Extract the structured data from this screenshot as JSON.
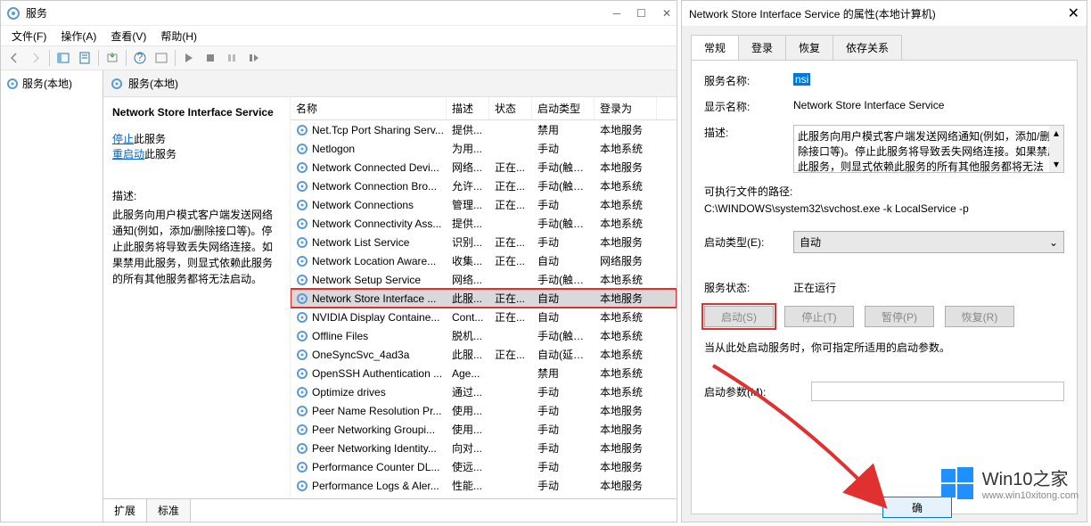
{
  "main": {
    "title": "服务",
    "menubar": [
      "文件(F)",
      "操作(A)",
      "查看(V)",
      "帮助(H)"
    ],
    "nav_root": "服务(本地)",
    "detail_header": "服务(本地)",
    "info": {
      "title": "Network Store Interface Service",
      "stop_link_prefix": "停止",
      "stop_link_suffix": "此服务",
      "restart_link_prefix": "重启动",
      "restart_link_suffix": "此服务",
      "desc_label": "描述:",
      "desc": "此服务向用户模式客户端发送网络通知(例如，添加/删除接口等)。停止此服务将导致丢失网络连接。如果禁用此服务，则显式依赖此服务的所有其他服务都将无法启动。"
    },
    "columns": [
      "名称",
      "描述",
      "状态",
      "启动类型",
      "登录为"
    ],
    "rows": [
      {
        "name": "Net.Tcp Port Sharing Serv...",
        "desc": "提供...",
        "status": "",
        "start": "禁用",
        "logon": "本地服务"
      },
      {
        "name": "Netlogon",
        "desc": "为用...",
        "status": "",
        "start": "手动",
        "logon": "本地系统"
      },
      {
        "name": "Network Connected Devi...",
        "desc": "网络...",
        "status": "正在...",
        "start": "手动(触发...",
        "logon": "本地服务"
      },
      {
        "name": "Network Connection Bro...",
        "desc": "允许...",
        "status": "正在...",
        "start": "手动(触发...",
        "logon": "本地系统"
      },
      {
        "name": "Network Connections",
        "desc": "管理...",
        "status": "正在...",
        "start": "手动",
        "logon": "本地系统"
      },
      {
        "name": "Network Connectivity Ass...",
        "desc": "提供...",
        "status": "",
        "start": "手动(触发...",
        "logon": "本地系统"
      },
      {
        "name": "Network List Service",
        "desc": "识别...",
        "status": "正在...",
        "start": "手动",
        "logon": "本地服务"
      },
      {
        "name": "Network Location Aware...",
        "desc": "收集...",
        "status": "正在...",
        "start": "自动",
        "logon": "网络服务"
      },
      {
        "name": "Network Setup Service",
        "desc": "网络...",
        "status": "",
        "start": "手动(触发...",
        "logon": "本地系统"
      },
      {
        "name": "Network Store Interface ...",
        "desc": "此服...",
        "status": "正在...",
        "start": "自动",
        "logon": "本地服务",
        "selected": true,
        "highlighted": true
      },
      {
        "name": "NVIDIA Display Containe...",
        "desc": "Cont...",
        "status": "正在...",
        "start": "自动",
        "logon": "本地系统"
      },
      {
        "name": "Offline Files",
        "desc": "脱机...",
        "status": "",
        "start": "手动(触发...",
        "logon": "本地系统"
      },
      {
        "name": "OneSyncSvc_4ad3a",
        "desc": "此服...",
        "status": "正在...",
        "start": "自动(延迟...",
        "logon": "本地系统"
      },
      {
        "name": "OpenSSH Authentication ...",
        "desc": "Age...",
        "status": "",
        "start": "禁用",
        "logon": "本地系统"
      },
      {
        "name": "Optimize drives",
        "desc": "通过...",
        "status": "",
        "start": "手动",
        "logon": "本地系统"
      },
      {
        "name": "Peer Name Resolution Pr...",
        "desc": "使用...",
        "status": "",
        "start": "手动",
        "logon": "本地服务"
      },
      {
        "name": "Peer Networking Groupi...",
        "desc": "使用...",
        "status": "",
        "start": "手动",
        "logon": "本地服务"
      },
      {
        "name": "Peer Networking Identity...",
        "desc": "向对...",
        "status": "",
        "start": "手动",
        "logon": "本地服务"
      },
      {
        "name": "Performance Counter DL...",
        "desc": "使远...",
        "status": "",
        "start": "手动",
        "logon": "本地服务"
      },
      {
        "name": "Performance Logs & Aler...",
        "desc": "性能...",
        "status": "",
        "start": "手动",
        "logon": "本地服务"
      }
    ],
    "bottom_tabs": [
      "扩展",
      "标准"
    ]
  },
  "props": {
    "title": "Network Store Interface Service 的属性(本地计算机)",
    "tabs": [
      "常规",
      "登录",
      "恢复",
      "依存关系"
    ],
    "labels": {
      "service_name": "服务名称:",
      "display_name": "显示名称:",
      "desc": "描述:",
      "exe_path": "可执行文件的路径:",
      "startup_type": "启动类型(E):",
      "service_status": "服务状态:",
      "start_params": "启动参数(M):",
      "hint": "当从此处启动服务时，你可指定所适用的启动参数。"
    },
    "values": {
      "service_name": "nsi",
      "display_name": "Network Store Interface Service",
      "desc": "此服务向用户模式客户端发送网络通知(例如，添加/删除接口等)。停止此服务将导致丢失网络连接。如果禁用此服务，则显式依赖此服务的所有其他服务都将无法",
      "exe_path": "C:\\WINDOWS\\system32\\svchost.exe -k LocalService -p",
      "startup_type": "自动",
      "service_status": "正在运行"
    },
    "buttons": {
      "start": "启动(S)",
      "stop": "停止(T)",
      "pause": "暂停(P)",
      "resume": "恢复(R)",
      "ok": "确"
    }
  },
  "watermark": {
    "brand": "Win10之家",
    "url": "www.win10xitong.com"
  }
}
